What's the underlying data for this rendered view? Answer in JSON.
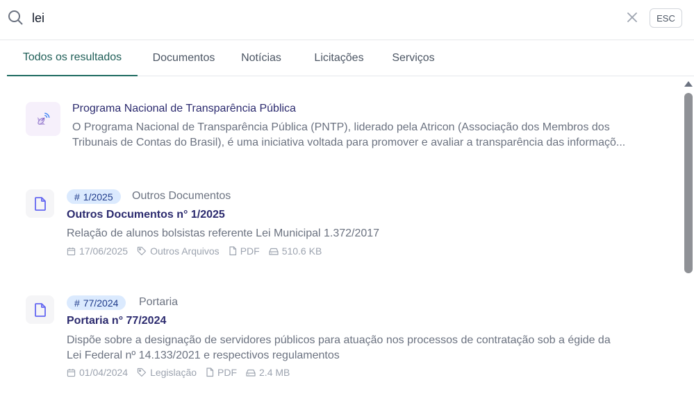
{
  "search": {
    "value": "lei",
    "esc_label": "ESC"
  },
  "tabs": [
    {
      "label": "Todos os resultados",
      "active": true
    },
    {
      "label": "Documentos",
      "active": false
    },
    {
      "label": "Notícias",
      "active": false
    },
    {
      "label": "Licitações",
      "active": false
    },
    {
      "label": "Serviços",
      "active": false
    }
  ],
  "results": [
    {
      "type": "service",
      "title": "Programa Nacional de Transparência Pública",
      "description_lines": [
        "O Programa Nacional de Transparência Pública (PNTP), liderado pela Atricon (Associação dos Membros dos",
        "Tribunais de Contas do Brasil), é uma iniciativa voltada para promover e avaliar a transparência das informaçõ..."
      ]
    },
    {
      "type": "document",
      "badge": "1/2025",
      "category": "Outros Documentos",
      "title": "Outros Documentos n° 1/2025",
      "description_lines": [
        "Relação de alunos bolsistas referente Lei Municipal 1.372/2017"
      ],
      "meta": {
        "date": "17/06/2025",
        "tag": "Outros Arquivos",
        "format": "PDF",
        "size": "510.6 KB"
      }
    },
    {
      "type": "document",
      "badge": "77/2024",
      "category": "Portaria",
      "title": "Portaria n° 77/2024",
      "description_lines": [
        "Dispõe sobre a designação de servidores públicos para atuação nos processos de contratação sob a égide da",
        "Lei Federal nº 14.133/2021 e respectivos regulamentos"
      ],
      "meta": {
        "date": "01/04/2024",
        "tag": "Legislação",
        "format": "PDF",
        "size": "2.4 MB"
      }
    }
  ],
  "colors": {
    "accent": "#1f6b61",
    "title": "#2b2a6e",
    "badge_bg": "#dbeafe",
    "doc_icon": "#6366f1"
  },
  "icons": [
    "search-icon",
    "close-icon",
    "satellite-icon",
    "file-icon",
    "calendar-icon",
    "tag-icon",
    "hard-drive-icon"
  ]
}
